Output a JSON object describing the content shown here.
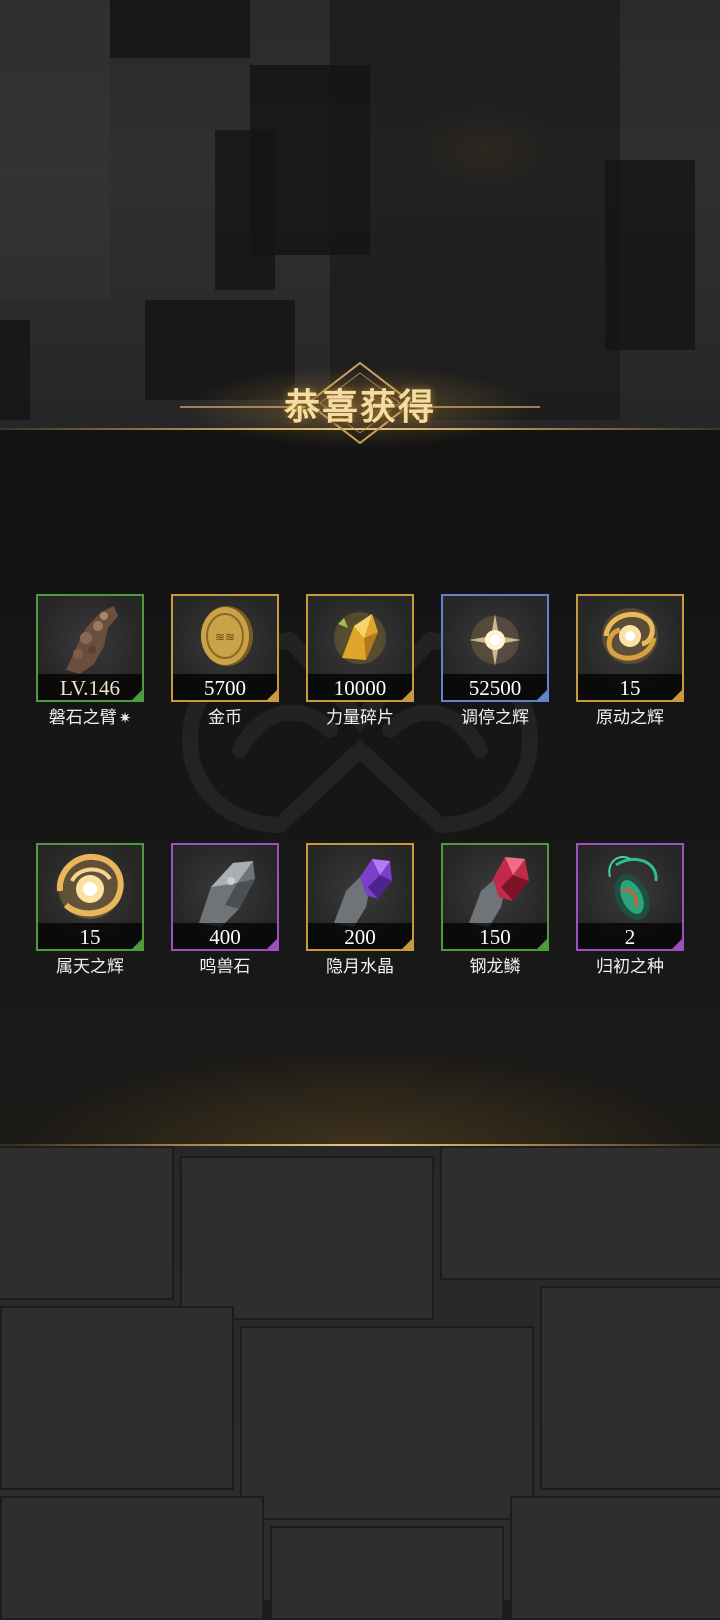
{
  "title": "恭喜获得",
  "rows": [
    {
      "items": [
        {
          "name": "磐石之臂",
          "count": "LV.146",
          "rarity": "green",
          "icon": "stone-arm-icon",
          "mark": "✷"
        },
        {
          "name": "金币",
          "count": "5700",
          "rarity": "gold",
          "icon": "gold-coin-icon"
        },
        {
          "name": "力量碎片",
          "count": "10000",
          "rarity": "gold",
          "icon": "power-shard-icon"
        },
        {
          "name": "调停之辉",
          "count": "52500",
          "rarity": "blue",
          "icon": "glow-orb-icon"
        },
        {
          "name": "原动之辉",
          "count": "15",
          "rarity": "gold",
          "icon": "swirl-orb-icon"
        }
      ]
    },
    {
      "items": [
        {
          "name": "属天之辉",
          "count": "15",
          "rarity": "green",
          "icon": "flame-orb-icon"
        },
        {
          "name": "鸣兽石",
          "count": "400",
          "rarity": "purple",
          "icon": "grey-crystal-icon"
        },
        {
          "name": "隐月水晶",
          "count": "200",
          "rarity": "gold",
          "icon": "purple-crystal-icon"
        },
        {
          "name": "钢龙鳞",
          "count": "150",
          "rarity": "green",
          "icon": "red-crystal-icon"
        },
        {
          "name": "归初之种",
          "count": "2",
          "rarity": "purple",
          "icon": "green-seed-icon"
        }
      ]
    }
  ],
  "colors": {
    "green": "#4f9a3f",
    "gold": "#c99a3d",
    "blue": "#5f84c9",
    "purple": "#9b52bc",
    "title": "#f3dca6"
  }
}
